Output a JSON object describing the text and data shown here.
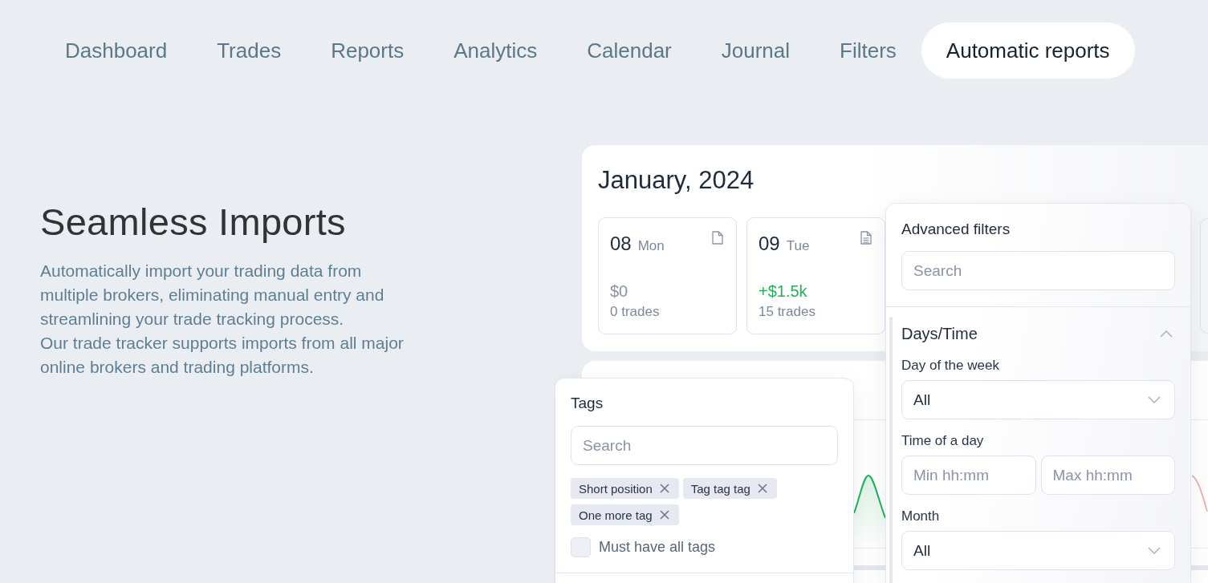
{
  "nav": {
    "items": [
      {
        "label": "Dashboard",
        "selected": false
      },
      {
        "label": "Trades",
        "selected": false
      },
      {
        "label": "Reports",
        "selected": false
      },
      {
        "label": "Analytics",
        "selected": false
      },
      {
        "label": "Calendar",
        "selected": false
      },
      {
        "label": "Journal",
        "selected": false
      },
      {
        "label": "Filters",
        "selected": false
      },
      {
        "label": "Automatic reports",
        "selected": true
      }
    ]
  },
  "hero": {
    "title": "Seamless Imports",
    "description": [
      "Automatically import your trading data from multiple brokers, eliminating manual entry and streamlining your trade tracking process.",
      "Our trade tracker supports imports from all major online brokers and trading platforms."
    ]
  },
  "calendar": {
    "title": "January, 2024",
    "days": [
      {
        "date": "08",
        "weekday": "Mon",
        "has_notes": false,
        "pnl": "$0",
        "color": "#8a93a6",
        "trades": "0 trades"
      },
      {
        "date": "09",
        "weekday": "Tue",
        "has_notes": true,
        "pnl": "+$1.5k",
        "color": "#22b05a",
        "trades": "15 trades"
      }
    ]
  },
  "tags_filter": {
    "title": "Tags",
    "search": {
      "placeholder": "Search"
    },
    "tags": [
      "Short position",
      "Tag tag tag",
      "One more tag"
    ],
    "match_all": {
      "label": "Must have all tags",
      "checked": false
    }
  },
  "advanced_filters": {
    "title": "Advanced filters",
    "search": {
      "placeholder": "Search"
    },
    "section": {
      "title": "Days/Time",
      "expanded": true,
      "fields": [
        {
          "kind": "select",
          "label": "Day of the week",
          "value": "All"
        },
        {
          "kind": "range",
          "label": "Time of a day",
          "min_placeholder": "Min hh:mm",
          "max_placeholder": "Max hh:mm"
        },
        {
          "kind": "select",
          "label": "Month",
          "value": "All"
        }
      ]
    }
  }
}
